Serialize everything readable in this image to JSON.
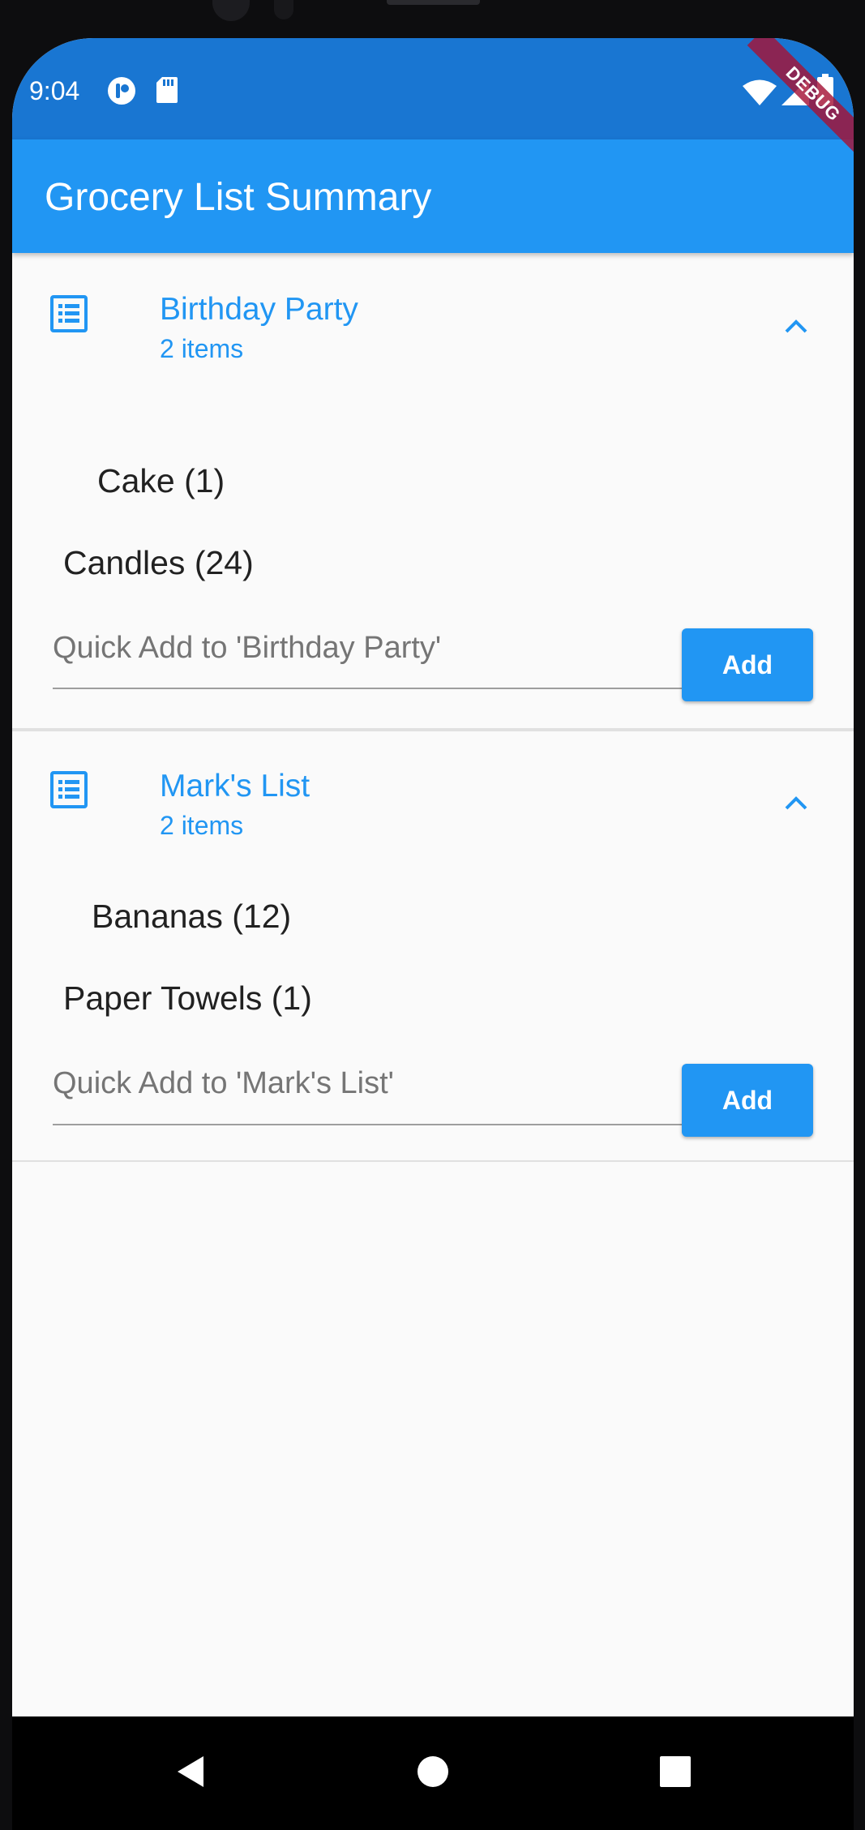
{
  "status_bar": {
    "time": "9:04",
    "left_icons": [
      "notification-app-icon",
      "sd-card-icon"
    ],
    "right_icons": [
      "wifi-icon",
      "cellular-signal-icon",
      "battery-icon"
    ]
  },
  "debug_banner": "DEBUG",
  "app_bar": {
    "title": "Grocery List Summary"
  },
  "lists": [
    {
      "title": "Birthday Party",
      "subtitle": "2 items",
      "icon": "list-icon",
      "expanded": true,
      "items": [
        "Cake (1)",
        "Candles (24)"
      ],
      "quick_add_placeholder": "Quick Add to 'Birthday Party'",
      "add_label": "Add"
    },
    {
      "title": "Mark's List",
      "subtitle": "2 items",
      "icon": "list-icon",
      "expanded": true,
      "items": [
        "Bananas (12)",
        "Paper Towels (1)"
      ],
      "quick_add_placeholder": "Quick Add to 'Mark's List'",
      "add_label": "Add"
    }
  ],
  "nav_bar": {
    "buttons": [
      "back-icon",
      "home-icon",
      "recents-icon"
    ]
  },
  "colors": {
    "status_bar": "#1976d2",
    "app_bar": "#2196f3",
    "accent": "#2196f3",
    "background": "#fafafa",
    "debug_banner": "#a51437"
  }
}
